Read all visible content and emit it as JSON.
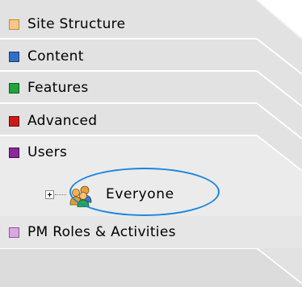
{
  "nav": {
    "items": [
      {
        "label": "Site Structure",
        "color": "#f4c78a",
        "border": "#c48a2a"
      },
      {
        "label": "Content",
        "color": "#2f6fc8",
        "border": "#1a3f7a"
      },
      {
        "label": "Features",
        "color": "#1fa53a",
        "border": "#0f5a1e"
      },
      {
        "label": "Advanced",
        "color": "#cc1a1a",
        "border": "#6e0a0a"
      },
      {
        "label": "Users",
        "color": "#8a2a9a",
        "border": "#4a1055"
      },
      {
        "label": "PM Roles & Activities",
        "color": "#d9a8e0",
        "border": "#8a5a92"
      }
    ],
    "active_index": 4
  },
  "tree": {
    "node_label": "Everyone",
    "icon": "user-group-icon",
    "expander": "plus"
  },
  "colors": {
    "tab_fill": "#e2e2e2",
    "active_tab_fill": "#efefef",
    "tab_edge": "#ffffff",
    "highlight_ring": "#1a86e0"
  }
}
